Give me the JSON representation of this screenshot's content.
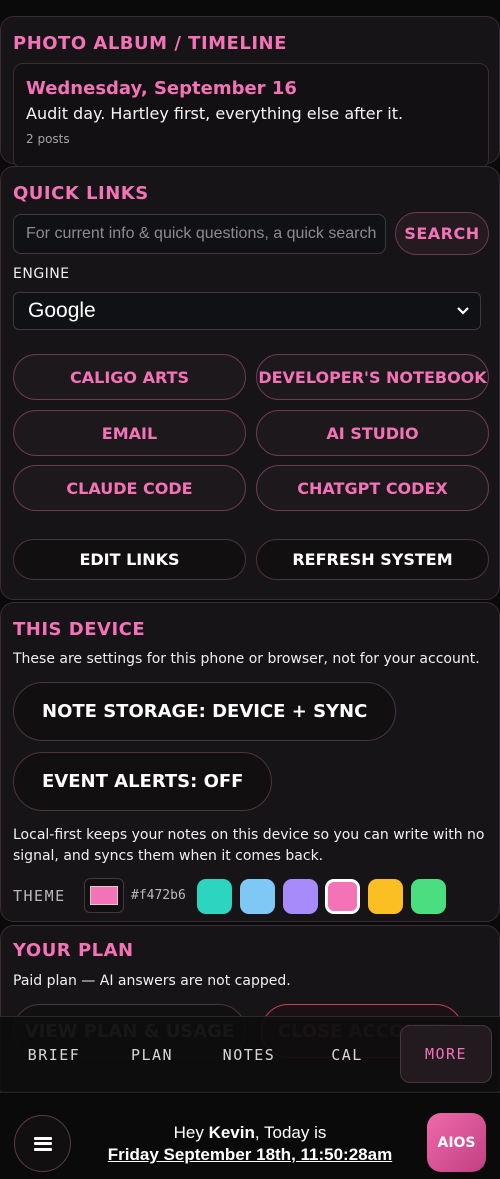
{
  "album": {
    "title": "PHOTO ALBUM / TIMELINE",
    "post": {
      "date": "Wednesday, September 16",
      "text": "Audit day. Hartley first, everything else after it.",
      "count": "2 posts"
    }
  },
  "quick_links": {
    "title": "QUICK LINKS",
    "search_placeholder": "For current info & quick questions, a quick search",
    "search_label": "SEARCH",
    "engine_label": "ENGINE",
    "engine_value": "Google",
    "links": [
      "CALIGO ARTS",
      "DEVELOPER'S NOTEBOOK",
      "EMAIL",
      "AI STUDIO",
      "CLAUDE CODE",
      "CHATGPT CODEX"
    ],
    "edit_label": "EDIT LINKS",
    "refresh_label": "REFRESH SYSTEM"
  },
  "device": {
    "title": "THIS DEVICE",
    "description": "These are settings for this phone or browser, not for your account.",
    "note_storage": "NOTE STORAGE: DEVICE + SYNC",
    "event_alerts": "EVENT ALERTS: OFF",
    "note": "Local-first keeps your notes on this device so you can write with no signal, and syncs them when it comes back.",
    "theme_label": "THEME",
    "theme_hex": "#f472b6",
    "swatches": [
      "#2dd4bf",
      "#7dc8f5",
      "#a78bfa",
      "#f472b6",
      "#fbbf24",
      "#4ade80"
    ],
    "selected_swatch": "#f472b6"
  },
  "plan": {
    "title": "YOUR PLAN",
    "description": "Paid plan — AI answers are not capped.",
    "view_label": "VIEW PLAN & USAGE",
    "close_label": "CLOSE ACCOUNT"
  },
  "tabs": [
    "BRIEF",
    "PLAN",
    "NOTES",
    "CAL",
    "MORE"
  ],
  "active_tab": "MORE",
  "footer": {
    "greeting_prefix": "Hey ",
    "user_name": "Kevin",
    "greeting_suffix": ", Today is",
    "datetime": "Friday September 18th, 11:50:28am",
    "aios_label": "AIOS"
  }
}
